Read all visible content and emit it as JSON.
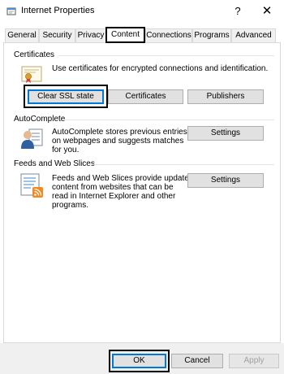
{
  "window": {
    "title": "Internet Properties",
    "help_glyph": "?",
    "close_glyph": "✕"
  },
  "tabs": [
    {
      "label": "General",
      "active": false
    },
    {
      "label": "Security",
      "active": false
    },
    {
      "label": "Privacy",
      "active": false
    },
    {
      "label": "Content",
      "active": true
    },
    {
      "label": "Connections",
      "active": false
    },
    {
      "label": "Programs",
      "active": false
    },
    {
      "label": "Advanced",
      "active": false
    }
  ],
  "certificates": {
    "group_label": "Certificates",
    "description": "Use certificates for encrypted connections and identification.",
    "clear_ssl_label": "Clear SSL state",
    "certificates_label": "Certificates",
    "publishers_label": "Publishers"
  },
  "autocomplete": {
    "group_label": "AutoComplete",
    "description_lines": [
      "AutoComplete stores previous entries",
      "on webpages and suggests matches",
      "for you."
    ],
    "settings_label": "Settings"
  },
  "feeds": {
    "group_label": "Feeds and Web Slices",
    "description_lines": [
      "Feeds and Web Slices provide updated",
      "content from websites that can be",
      "read in Internet Explorer and other",
      "programs."
    ],
    "settings_label": "Settings"
  },
  "footer": {
    "ok_label": "OK",
    "cancel_label": "Cancel",
    "apply_label": "Apply"
  },
  "colors": {
    "focus_blue": "#0078d7",
    "highlight_box": "#000000",
    "button_face": "#e1e1e1"
  }
}
